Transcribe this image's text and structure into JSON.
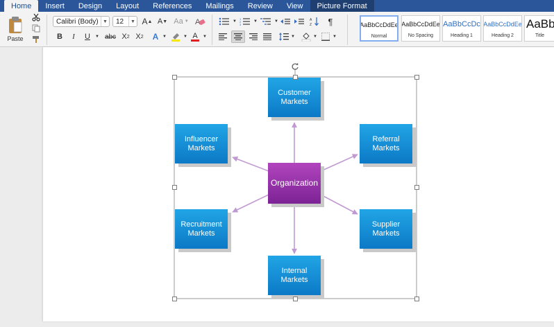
{
  "tabs": [
    {
      "label": "Home",
      "active": true
    },
    {
      "label": "Insert"
    },
    {
      "label": "Design"
    },
    {
      "label": "Layout"
    },
    {
      "label": "References"
    },
    {
      "label": "Mailings"
    },
    {
      "label": "Review"
    },
    {
      "label": "View"
    },
    {
      "label": "Picture Format"
    }
  ],
  "ribbon": {
    "paste_label": "Paste",
    "font_name": "Calibri (Body)",
    "font_size": "12",
    "bold": "B",
    "italic": "I",
    "underline": "U",
    "strike": "abc",
    "sub": "X",
    "sub_mark": "2",
    "sup": "X",
    "sup_mark": "2",
    "grow": "A",
    "shrink": "A",
    "case": "Aa",
    "para_mark": "¶",
    "text_effects": "A",
    "font_color": "A",
    "highlight_color": "#f6e600",
    "font_color_bar": "#e02020"
  },
  "styles": [
    {
      "preview": "AaBbCcDdEe",
      "name": "Normal",
      "selected": true
    },
    {
      "preview": "AaBbCcDdEe",
      "name": "No Spacing"
    },
    {
      "preview": "AaBbCcDc",
      "name": "Heading 1"
    },
    {
      "preview": "AaBbCcDdEe",
      "name": "Heading 2"
    },
    {
      "preview": "AaBbC",
      "name": "Title"
    }
  ],
  "diagram": {
    "center": "Organization",
    "nodes": [
      {
        "key": "customer",
        "label": "Customer Markets"
      },
      {
        "key": "influencer",
        "label": "Influencer Markets"
      },
      {
        "key": "referral",
        "label": "Referral Markets"
      },
      {
        "key": "recruitment",
        "label": "Recruitment Markets"
      },
      {
        "key": "supplier",
        "label": "Supplier Markets"
      },
      {
        "key": "internal",
        "label": "Internal Markets"
      }
    ]
  },
  "colors": {
    "ribbon_blue": "#2b579a",
    "node_blue": "#1a94dc",
    "center_purple": "#9a34ad",
    "arrow": "#c199d2"
  }
}
